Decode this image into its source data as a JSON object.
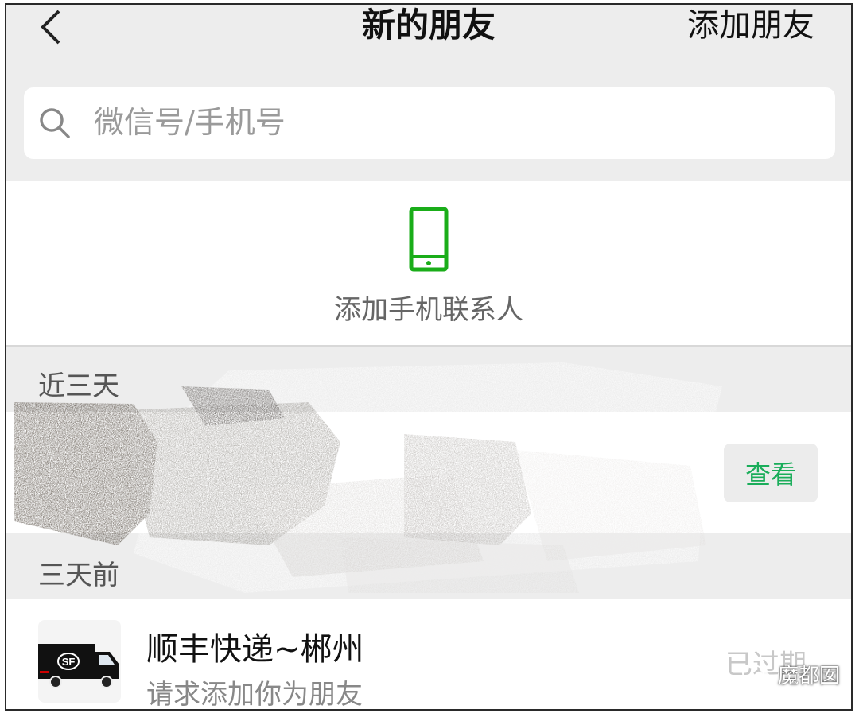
{
  "header": {
    "title": "新的朋友",
    "add_friend_label": "添加朋友"
  },
  "search": {
    "placeholder": "微信号/手机号"
  },
  "phone_contacts": {
    "label": "添加手机联系人",
    "icon": "phone-icon",
    "accent": "#1aad19"
  },
  "sections": {
    "recent": "近三天",
    "older": "三天前"
  },
  "recent_request": {
    "button_label": "查看",
    "button_color": "#1aad5a"
  },
  "older_request": {
    "name": "顺丰快递~郴州",
    "message": "请求添加你为朋友",
    "status": "已过期",
    "avatar_text": "SF"
  },
  "watermark": {
    "text": "魔都囡"
  }
}
